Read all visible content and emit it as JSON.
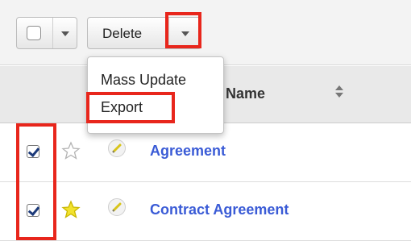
{
  "toolbar": {
    "delete_label": "Delete",
    "menu": [
      {
        "label": "Mass Update"
      },
      {
        "label": "Export"
      }
    ]
  },
  "table": {
    "column_title": "nt Name",
    "rows": [
      {
        "name": "Agreement",
        "checked": true,
        "favorite": false
      },
      {
        "name": "Contract Agreement",
        "checked": true,
        "favorite": true
      }
    ]
  },
  "colors": {
    "highlight": "#e8261c",
    "link": "#3a5bd6",
    "favorite_star": "#f2e22e"
  },
  "icons": [
    "checkbox-icon",
    "chevron-down-icon",
    "sort-icon",
    "star-icon",
    "pencil-icon",
    "checkmark-icon"
  ]
}
